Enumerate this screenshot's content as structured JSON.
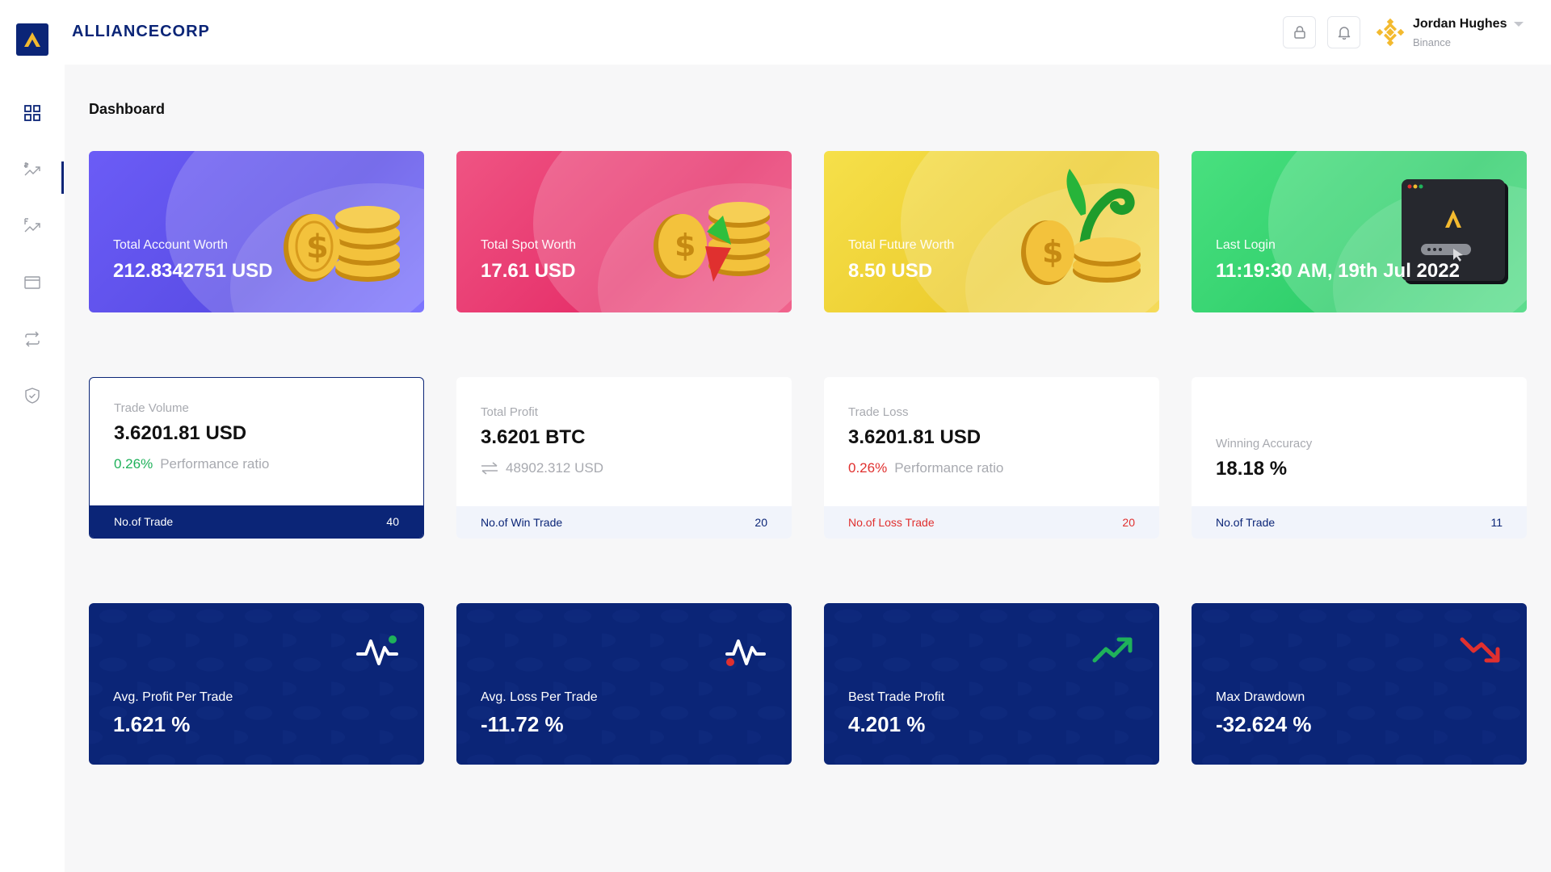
{
  "brand": {
    "name": "ALLIANCECORP"
  },
  "user": {
    "name": "Jordan Hughes",
    "exchange": "Binance"
  },
  "page": {
    "title": "Dashboard"
  },
  "sidebar": {
    "items": [
      {
        "name": "dashboard",
        "icon": "grid-icon",
        "active": true
      },
      {
        "name": "spot",
        "icon": "spot-trend-icon"
      },
      {
        "name": "futures",
        "icon": "futures-trend-icon"
      },
      {
        "name": "wallet",
        "icon": "wallet-icon"
      },
      {
        "name": "transfer",
        "icon": "transfer-icon"
      },
      {
        "name": "security",
        "icon": "shield-icon"
      }
    ]
  },
  "hero_cards": [
    {
      "label": "Total Account Worth",
      "value": "212.8342751 USD",
      "color": "#6b5cf6"
    },
    {
      "label": "Total Spot Worth",
      "value": "17.61 USD",
      "color": "#e6306a"
    },
    {
      "label": "Total Future Worth",
      "value": "8.50 USD",
      "color": "#eccc2e"
    },
    {
      "label": "Last Login",
      "value": "11:19:30 AM, 19th Jul 2022",
      "color": "#2fce6b"
    }
  ],
  "stat_cards": {
    "trade_volume": {
      "label": "Trade Volume",
      "value": "3.6201.81 USD",
      "pct": "0.26%",
      "pct_text": "Performance ratio",
      "footer_label": "No.of Trade",
      "footer_value": "40"
    },
    "total_profit": {
      "label": "Total Profit",
      "value": "3.6201 BTC",
      "sub": "48902.312 USD",
      "footer_label": "No.of Win Trade",
      "footer_value": "20"
    },
    "trade_loss": {
      "label": "Trade Loss",
      "value": "3.6201.81 USD",
      "pct": "0.26%",
      "pct_text": "Performance ratio",
      "footer_label": "No.of Loss Trade",
      "footer_value": "20"
    },
    "winning_accuracy": {
      "label": "Winning Accuracy",
      "value": "18.18 %",
      "footer_label": "No.of Trade",
      "footer_value": "11"
    }
  },
  "metric_cards": [
    {
      "label": "Avg. Profit Per Trade",
      "value": "1.621 %",
      "icon": "pulse-green-dot-icon"
    },
    {
      "label": "Avg. Loss Per Trade",
      "value": "-11.72 %",
      "icon": "pulse-red-dot-icon"
    },
    {
      "label": "Best Trade Profit",
      "value": "4.201 %",
      "icon": "trend-up-icon"
    },
    {
      "label": "Max Drawdown",
      "value": "-32.624 %",
      "icon": "trend-down-icon"
    }
  ],
  "colors": {
    "navy": "#0b2577",
    "green": "#1fb15a",
    "red": "#e0302f",
    "gold": "#f3ba2f"
  }
}
